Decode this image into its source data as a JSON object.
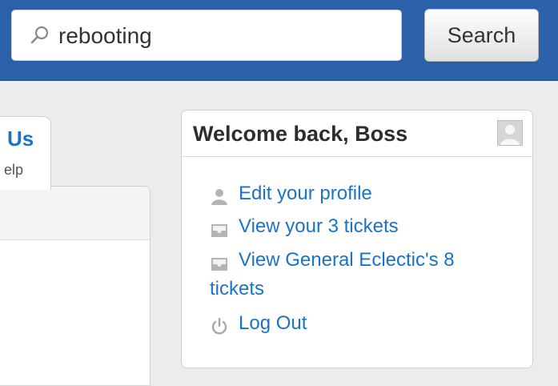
{
  "search": {
    "value": "rebooting",
    "button_label": "Search"
  },
  "tab": {
    "title": "Us",
    "subtitle": "elp"
  },
  "welcome": {
    "title": "Welcome back, Boss",
    "menu": [
      {
        "label": "Edit your profile",
        "icon": "user-icon"
      },
      {
        "label": "View your 3 tickets",
        "icon": "tray-icon"
      },
      {
        "label_line1": "View General Eclectic's 8",
        "label_line2": "tickets",
        "icon": "tray-icon"
      },
      {
        "label": "Log Out",
        "icon": "power-icon"
      }
    ]
  },
  "colors": {
    "header": "#2a61a8",
    "link": "#1a73c9",
    "background": "#ececec"
  }
}
